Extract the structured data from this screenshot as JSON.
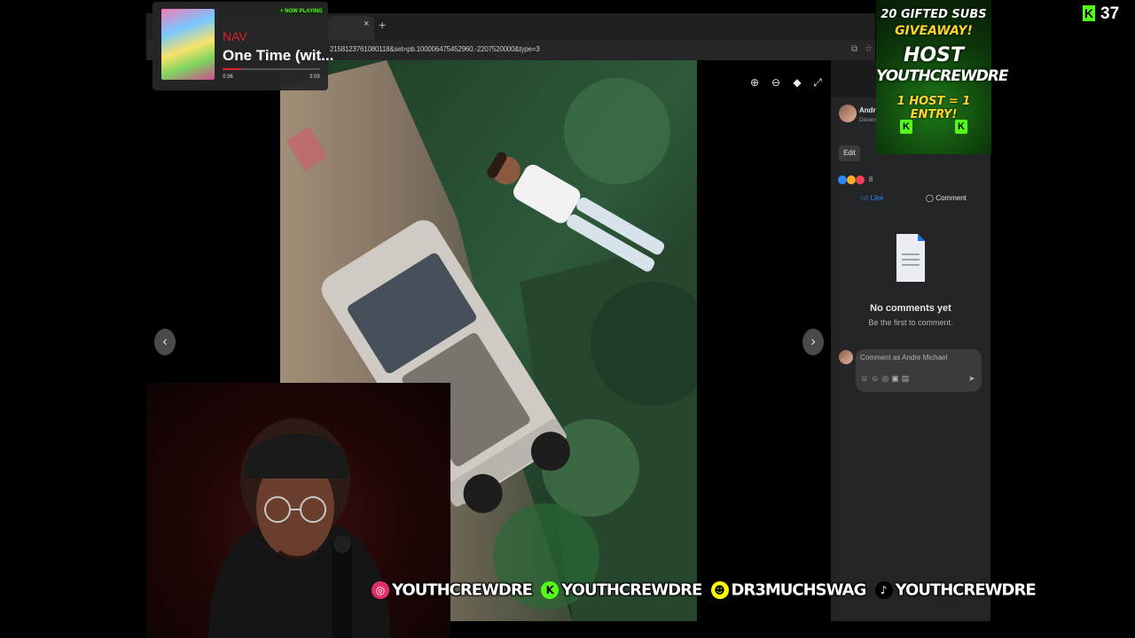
{
  "browser": {
    "tab_close": "×",
    "new_tab": "+",
    "url": "2158123761080118&set=pb.100006475452960.-2207520000&type=3"
  },
  "viewer": {
    "prev": "‹",
    "next": "›",
    "tools": [
      "zoom-in-icon",
      "zoom-out-icon",
      "tag-icon",
      "fullscreen-icon"
    ]
  },
  "post": {
    "author": "Andre",
    "date": "Decem",
    "edit_label": "Edit",
    "reaction_count": "8",
    "like_label": "Like",
    "comment_label": "Comment",
    "no_comments_title": "No comments yet",
    "no_comments_sub": "Be the first to comment.",
    "comment_placeholder": "Comment as Andre Michael"
  },
  "now_playing": {
    "badge": "+ NOW PLAYING",
    "artist": "NAV",
    "title": "One Time (wit...",
    "elapsed": "0:36",
    "total": "3:09",
    "progress_fraction": 0.19
  },
  "giveaway": {
    "line1": "20 GIFTED SUBS",
    "line2": "GIVEAWAY!",
    "line3": "HOST",
    "line4": "YOUTHCREWDRE",
    "line5": "1 HOST = 1 ENTRY!"
  },
  "viewer_count": "37",
  "socials": [
    {
      "platform": "instagram",
      "handle": "YOUTHCREWDRE",
      "color": "#e1306c"
    },
    {
      "platform": "kick",
      "handle": "YOUTHCREWDRE",
      "color": "#53fc18"
    },
    {
      "platform": "snapchat",
      "handle": "DR3MUCHSWAG",
      "color": "#fffc00"
    },
    {
      "platform": "tiktok",
      "handle": "YOUTHCREWDRE",
      "color": "#000000"
    }
  ]
}
